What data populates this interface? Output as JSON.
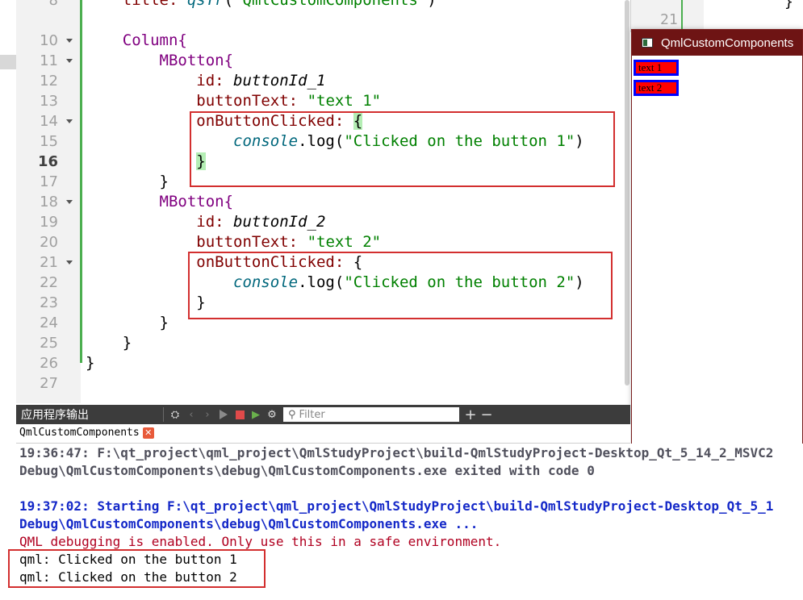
{
  "editor": {
    "line_numbers": [
      "8",
      "10",
      "11",
      "12",
      "13",
      "14",
      "15",
      "16",
      "17",
      "18",
      "19",
      "20",
      "21",
      "22",
      "23",
      "24",
      "25",
      "26",
      "27"
    ],
    "current_line": "16",
    "title_line": {
      "prop": "title: ",
      "func": "qsTr",
      "open": "(\"",
      "value": "QmlCustomComponents",
      "close": "\")"
    },
    "column_kw": "Column{",
    "mbotton_kw": "MBotton{",
    "id_prop": "id: ",
    "id_1": "buttonId_1",
    "id_2": "buttonId_2",
    "text_prop": "buttonText: ",
    "text_1": "\"text 1\"",
    "text_2": "\"text 2\"",
    "handler": "onButtonClicked: ",
    "open_brace": "{",
    "close_brace": "}",
    "console_obj": "console",
    "log_call": ".log(",
    "msg_1": "\"Clicked on the button 1\"",
    "msg_2": "\"Clicked on the button 2\"",
    "close_paren": ")"
  },
  "right_editor": {
    "line_number": "21",
    "brace": "}"
  },
  "popup": {
    "title": "QmlCustomComponents",
    "buttons": [
      "text 1",
      "text 2"
    ]
  },
  "output": {
    "pane_title": "应用程序输出",
    "filter_placeholder": "Filter",
    "tab_label": "QmlCustomComponents",
    "tab_close": "✕",
    "add_label": "+",
    "remove_label": "−",
    "lines": [
      "19:36:47: F:\\qt_project\\qml_project\\QmlStudyProject\\build-QmlStudyProject-Desktop_Qt_5_14_2_MSVC2",
      "Debug\\QmlCustomComponents\\debug\\QmlCustomComponents.exe exited with code 0",
      "19:37:02: Starting F:\\qt_project\\qml_project\\QmlStudyProject\\build-QmlStudyProject-Desktop_Qt_5_1",
      "Debug\\QmlCustomComponents\\debug\\QmlCustomComponents.exe ...",
      "QML debugging is enabled. Only use this in a safe environment.",
      "qml: Clicked on the button 1",
      "qml: Clicked on the button 2"
    ]
  },
  "colors": {
    "highlight_box": "#d32f2f",
    "popup_titlebar": "#6e1414",
    "qml_button_fill": "#ff0000",
    "qml_button_border": "#0000ff"
  }
}
